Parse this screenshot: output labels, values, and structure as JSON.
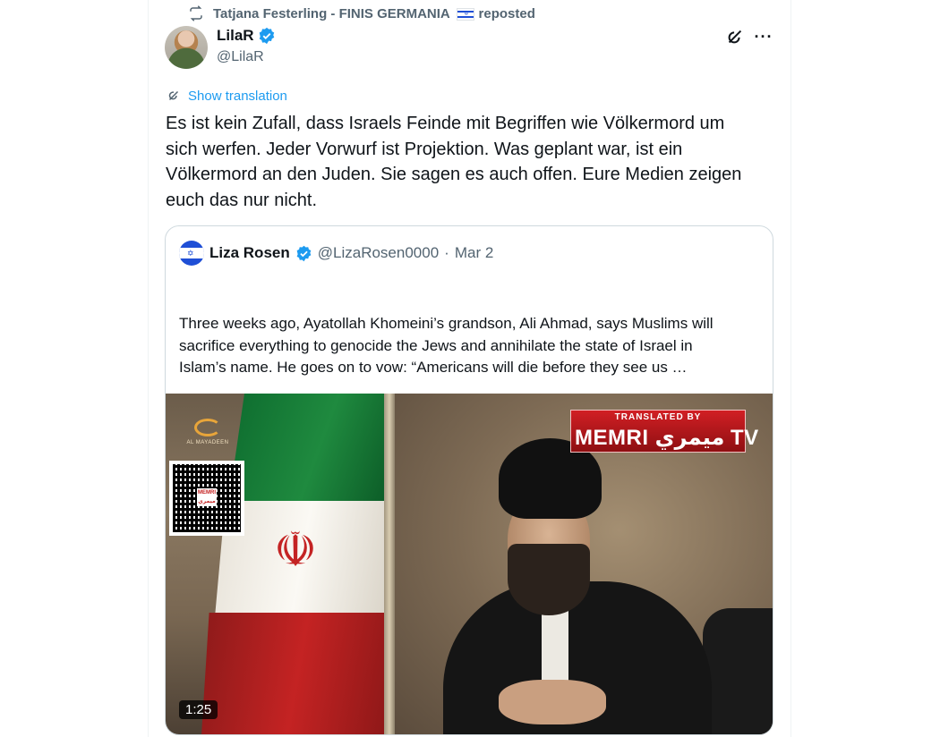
{
  "repost": {
    "name": "Tatjana Festerling - FINIS GERMANIA",
    "label": "reposted",
    "flag_icon": "israel-flag-emoji"
  },
  "author": {
    "display_name": "LilaR",
    "handle": "@LilaR",
    "verified": true
  },
  "actions": {
    "grok_icon": "grok-icon",
    "more_label": "···"
  },
  "translate": {
    "label": "Show translation"
  },
  "tweet": {
    "text": "Es ist kein Zufall, dass Israels Feinde mit Begriffen wie Völkermord um\nsich werfen. Jeder Vorwurf ist Projektion. Was geplant war, ist ein\nVölkermord an den Juden. Sie sagen es auch offen. Eure Medien zeigen\neuch das nur nicht."
  },
  "quote": {
    "name": "Liza Rosen",
    "handle": "@LizaRosen0000",
    "separator": "·",
    "date": "Mar 2",
    "verified": true,
    "text": "Three weeks ago, Ayatollah Khomeini’s grandson, Ali Ahmad, says Muslims will\nsacrifice everything to genocide the Jews and annihilate the state of Israel in\nIslam’s name. He goes on to vow: “Americans will die before they see us …"
  },
  "video": {
    "duration": "1:25",
    "watermark_top": "TRANSLATED BY",
    "watermark_main": "MEMRI ميمري TV",
    "channel_logo": "AL MAYADEEN",
    "qr_label": "MEMRI ميمري"
  },
  "colors": {
    "accent": "#1d9bf0",
    "text": "#0f1419",
    "secondary": "#536471",
    "border": "#cfd9de"
  }
}
